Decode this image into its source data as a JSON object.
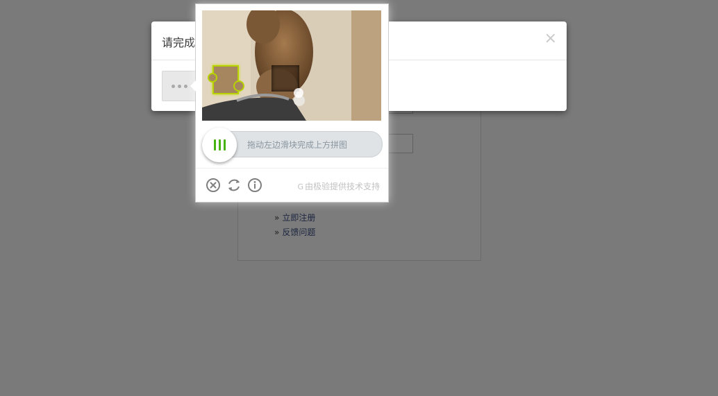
{
  "modal": {
    "title": "请完成",
    "close_glyph": "×"
  },
  "login": {
    "links": [
      {
        "arrow": "»",
        "label": "立即注册"
      },
      {
        "arrow": "»",
        "label": "反馈问题"
      }
    ]
  },
  "captcha": {
    "slider_hint": "拖动左边滑块完成上方拼图",
    "brand": "由极验提供技术支持",
    "brand_icon": "G"
  },
  "colors": {
    "overlay": "#7a7a7a",
    "accent_green": "#47b30e",
    "piece_outline": "#b7d200"
  }
}
